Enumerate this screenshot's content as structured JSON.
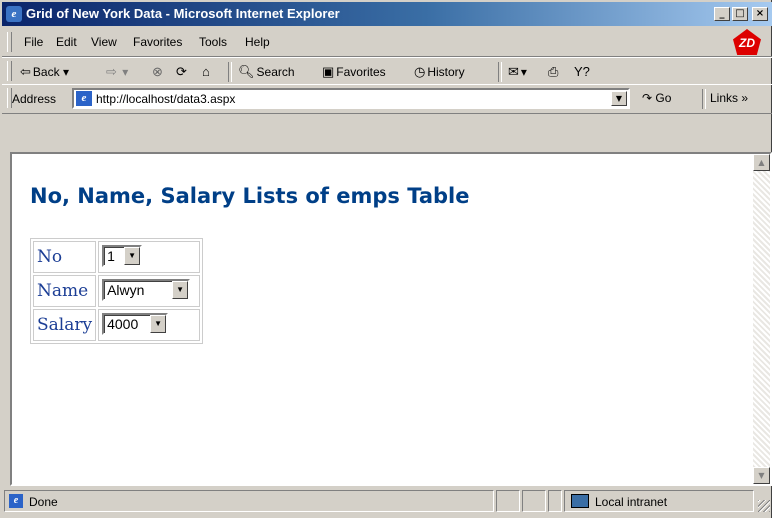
{
  "window": {
    "title": "Grid of New York Data - Microsoft Internet Explorer",
    "controls": [
      "_",
      "□",
      "×"
    ]
  },
  "menu": {
    "items": [
      "File",
      "Edit",
      "View",
      "Favorites",
      "Tools",
      "Help"
    ]
  },
  "toolbar": {
    "back": "Back",
    "search": "Search",
    "favorites": "Favorites",
    "history": "History"
  },
  "address": {
    "label": "Address",
    "url": "http://localhost/data3.aspx",
    "go": "Go",
    "links": "Links"
  },
  "page": {
    "heading": "No, Name, Salary Lists of emps Table",
    "rows": [
      {
        "label": "No",
        "value": "1"
      },
      {
        "label": "Name",
        "value": "Alwyn"
      },
      {
        "label": "Salary",
        "value": "4000"
      }
    ]
  },
  "status": {
    "text": "Done",
    "zone": "Local intranet"
  }
}
